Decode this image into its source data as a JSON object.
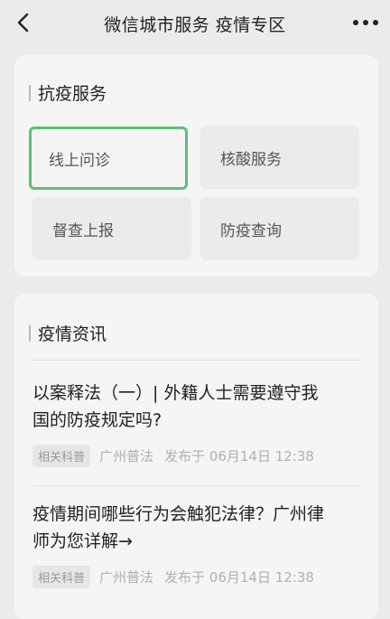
{
  "nav": {
    "title": "微信城市服务 疫情专区",
    "back_icon": "chevron-left-icon",
    "more_icon": "more-dots-icon"
  },
  "services": {
    "title": "抗疫服务",
    "items": [
      {
        "label": "线上问诊",
        "selected": true
      },
      {
        "label": "核酸服务",
        "selected": false
      },
      {
        "label": "督查上报",
        "selected": false
      },
      {
        "label": "防疫查询",
        "selected": false
      }
    ]
  },
  "news": {
    "title": "疫情资讯",
    "articles": [
      {
        "line1": "以案释法（一）| 外籍人士需要遵守我",
        "line2": "国的防疫规定吗?",
        "tag": "相关科普",
        "source": "广州普法",
        "published": "发布于 06月14日 12:38"
      },
      {
        "line1": "疫情期间哪些行为会触犯法律？广州律",
        "line2": "师为您详解→",
        "tag": "相关科普",
        "source": "广州普法",
        "published": "发布于 06月14日 12:38"
      }
    ]
  },
  "colors": {
    "background": "#ebebeb",
    "card": "#f5f5f5",
    "selected_border": "#5ac07a"
  }
}
